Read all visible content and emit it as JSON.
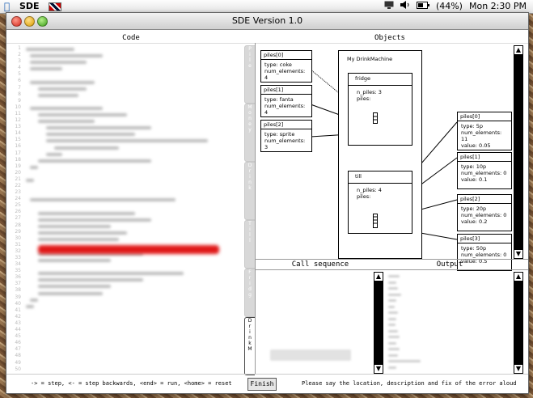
{
  "menubar": {
    "app_name": "SDE",
    "battery": "(44%)",
    "clock": "Mon 2:30 PM"
  },
  "window": {
    "title": "SDE Version 1.0"
  },
  "panels": {
    "code_title": "Code",
    "objects_title": "Objects",
    "call_sequence_title": "Call sequence",
    "output_title": "Output"
  },
  "tabs": {
    "active_label": "DrinkM"
  },
  "objects": {
    "left_piles": [
      {
        "header": "piles[0]",
        "type": "type: coke",
        "num": "num_elements: 4"
      },
      {
        "header": "piles[1]",
        "type": "type: fanta",
        "num": "num_elements: 4"
      },
      {
        "header": "piles[2]",
        "type": "type: sprite",
        "num": "num_elements: 3"
      }
    ],
    "machine": {
      "title": "My DrinkMachine",
      "fridge": {
        "title": "fridge",
        "n_piles": "n_piles: 3",
        "piles": "piles:"
      },
      "till": {
        "title": "till",
        "n_piles": "n_piles: 4",
        "piles": "piles:"
      }
    },
    "right_piles": [
      {
        "header": "piles[0]",
        "type": "type: 5p",
        "num": "num_elements: 11",
        "value": "value: 0.05"
      },
      {
        "header": "piles[1]",
        "type": "type: 10p",
        "num": "num_elements: 0",
        "value": "value: 0.1"
      },
      {
        "header": "piles[2]",
        "type": "type: 20p",
        "num": "num_elements: 0",
        "value": "value: 0.2"
      },
      {
        "header": "piles[3]",
        "type": "type: 50p",
        "num": "num_elements: 0",
        "value": "value: 0.5"
      }
    ]
  },
  "bottom": {
    "help_text": "-> = step, <- = step backwards, <end> = run, <home> = reset",
    "finish_label": "Finish",
    "instruction": "Please say the location, description and fix of the error aloud"
  },
  "colors": {
    "error_highlight": "#e01818",
    "window_bg": "#ffffff"
  }
}
